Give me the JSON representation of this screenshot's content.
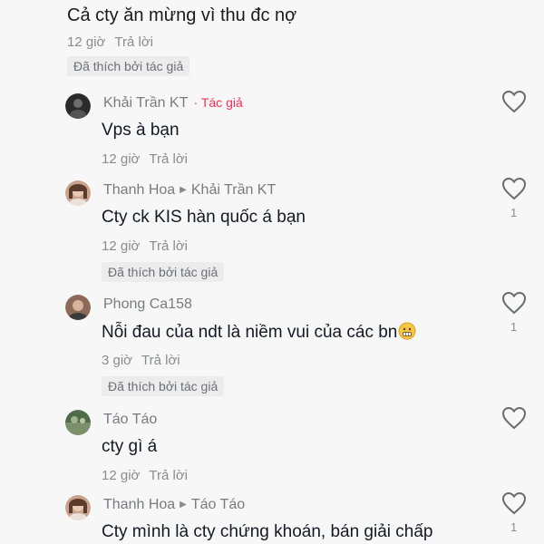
{
  "top_comment": {
    "text": "Cả cty ăn mừng vì thu đc nợ",
    "time": "12 giờ",
    "reply_label": "Trả lời",
    "liked_badge": "Đã thích bởi tác giả"
  },
  "comments": [
    {
      "name": "Khải Trần KT",
      "author_tag": "· Tác giả",
      "reply_to": "",
      "text": "Vps à bạn",
      "time": "12 giờ",
      "reply_label": "Trả lời",
      "liked_badge": "",
      "likes": ""
    },
    {
      "name": "Thanh Hoa",
      "author_tag": "",
      "reply_to": "Khải Trần KT",
      "text": "Cty ck KIS hàn quốc á bạn",
      "time": "12 giờ",
      "reply_label": "Trả lời",
      "liked_badge": "Đã thích bởi tác giả",
      "likes": "1"
    },
    {
      "name": "Phong Ca158",
      "author_tag": "",
      "reply_to": "",
      "text": "Nỗi đau của ndt là niềm vui của các bn",
      "time": "3 giờ",
      "reply_label": "Trả lời",
      "liked_badge": "Đã thích bởi tác giả",
      "likes": "1"
    },
    {
      "name": "Táo Táo",
      "author_tag": "",
      "reply_to": "",
      "text": "cty gì á",
      "time": "12 giờ",
      "reply_label": "Trả lời",
      "liked_badge": "",
      "likes": ""
    },
    {
      "name": "Thanh Hoa",
      "author_tag": "",
      "reply_to": "Táo Táo",
      "text": "Cty mình là cty chứng khoán, bán giải chấp",
      "time": "",
      "reply_label": "",
      "liked_badge": "",
      "likes": "1"
    }
  ],
  "icons": {
    "heart": "heart-outline-icon",
    "reply_arrow": "reply-arrow-icon",
    "emoji": "grimacing-face-emoji"
  },
  "colors": {
    "background": "#f7f7f7",
    "author_tag": "#fe2c55",
    "secondary_text": "#8a8b91",
    "badge_bg": "#ececec"
  }
}
